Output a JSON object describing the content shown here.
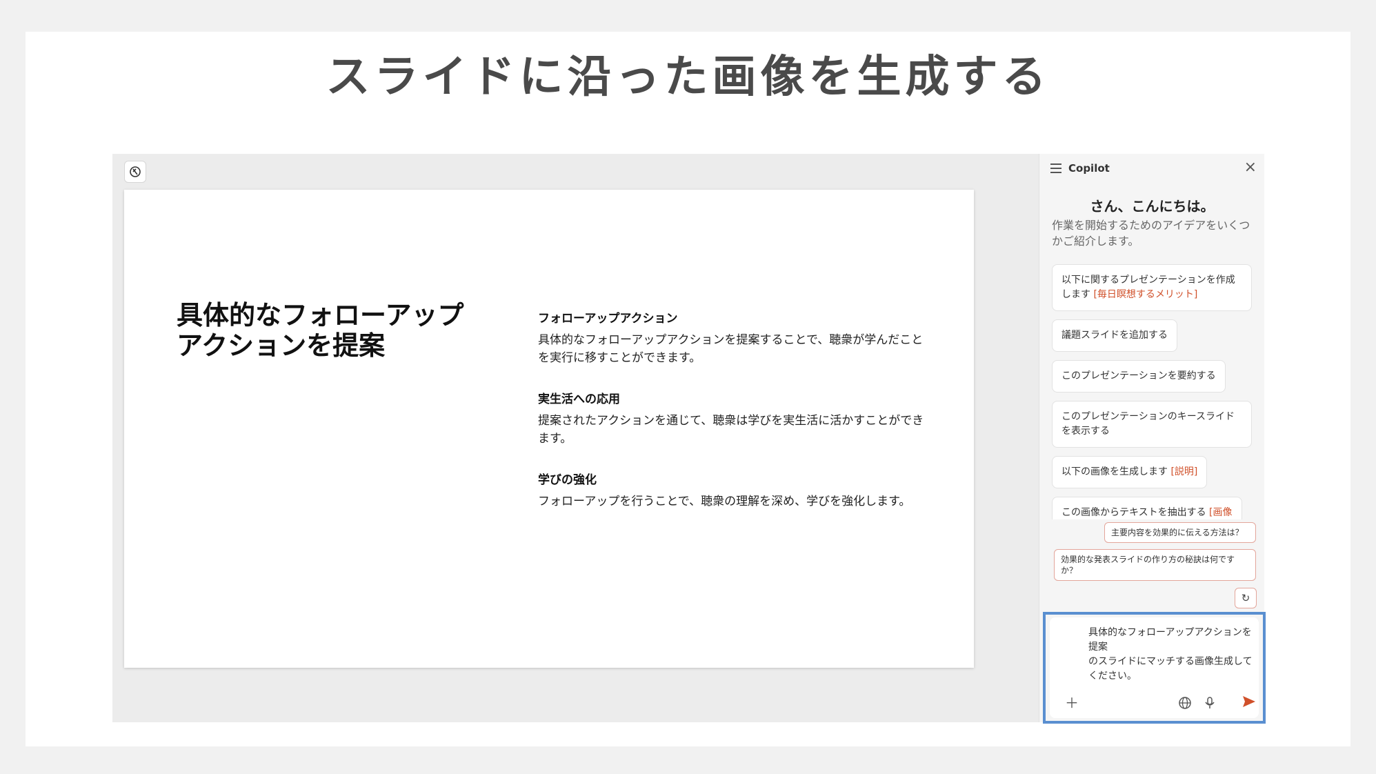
{
  "page_title": "スライドに沿った画像を生成する",
  "slide": {
    "title": "具体的なフォローアップアクションを提案",
    "sections": [
      {
        "heading": "フォローアップアクション",
        "text": "具体的なフォローアップアクションを提案することで、聴衆が学んだことを実行に移すことができます。"
      },
      {
        "heading": "実生活への応用",
        "text": "提案されたアクションを通じて、聴衆は学びを実生活に活かすことができます。"
      },
      {
        "heading": "学びの強化",
        "text": "フォローアップを行うことで、聴衆の理解を深め、学びを強化します。"
      }
    ]
  },
  "copilot": {
    "title": "Copilot",
    "greeting": "さん、こんにちは。",
    "greeting_sub": "作業を開始するためのアイデアをいくつかご紹介します。",
    "suggestions": [
      {
        "text": "以下に関するプレゼンテーションを作成します ",
        "highlight": "[毎日瞑想するメリット]"
      },
      {
        "text": "議題スライドを追加する",
        "highlight": ""
      },
      {
        "text": "このプレゼンテーションを要約する",
        "highlight": ""
      },
      {
        "text": "このプレゼンテーションのキースライドを表示する",
        "highlight": ""
      },
      {
        "text": "以下の画像を生成します ",
        "highlight": "[説明]"
      },
      {
        "text": "この画像からテキストを抽出する ",
        "highlight": "[画像"
      }
    ],
    "quick_prompts": [
      "主要内容を効果的に伝える方法は？",
      "効果的な発表スライドの作り方の秘訣は何ですか？"
    ],
    "input_text": "具体的なフォローアップアクションを提案\nのスライドにマッチする画像生成してください。"
  },
  "icons": {
    "designer": "designer-icon",
    "menu": "hamburger-icon",
    "close": "close-icon",
    "refresh": "refresh-icon",
    "add": "plus-icon",
    "globe": "globe-icon",
    "mic": "microphone-icon",
    "send": "send-icon"
  },
  "colors": {
    "accent": "#d0502a",
    "highlight_border": "#5a8fd0"
  }
}
